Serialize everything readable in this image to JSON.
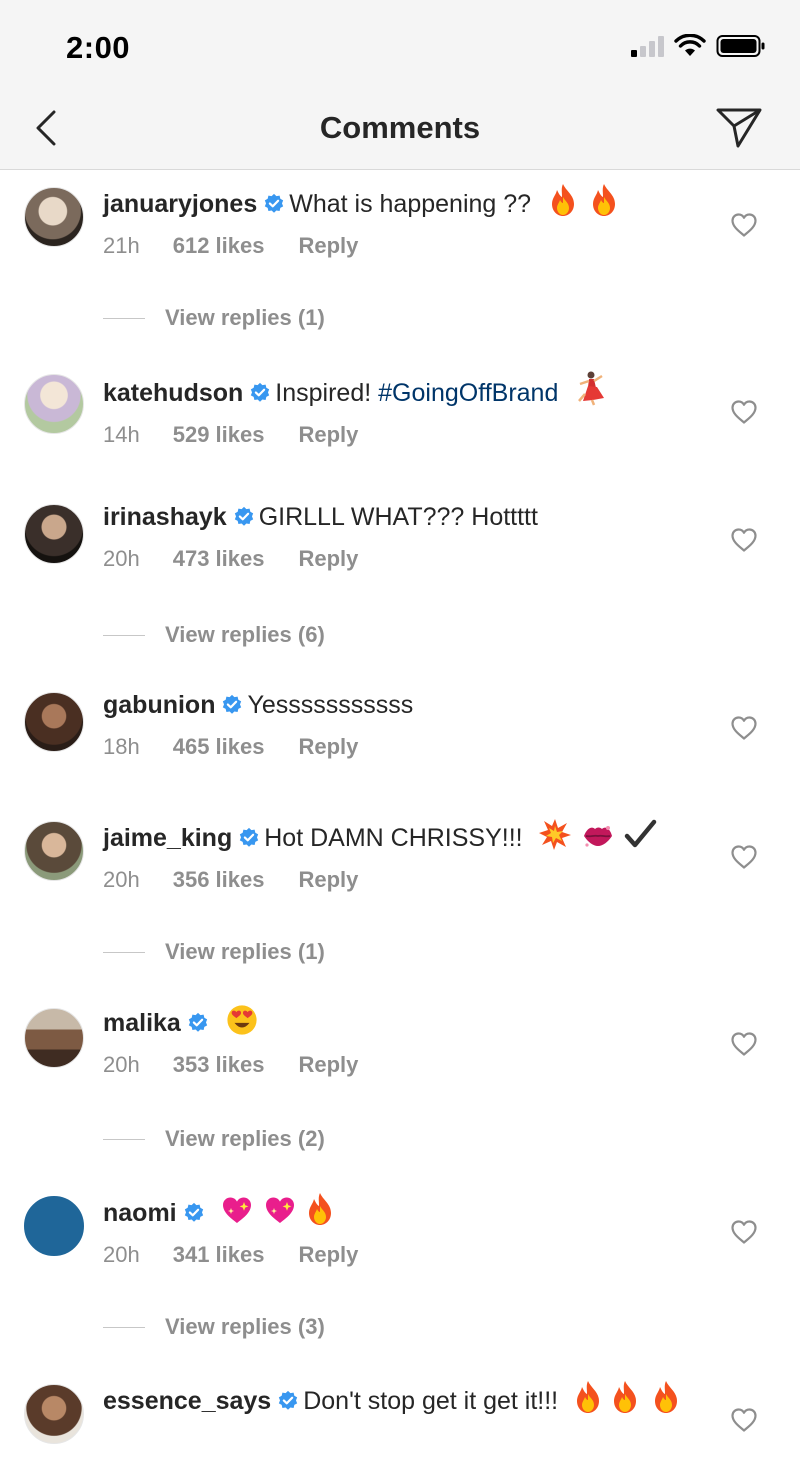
{
  "status_bar": {
    "time": "2:00"
  },
  "header": {
    "title": "Comments"
  },
  "comments": [
    {
      "username": "januaryjones",
      "verified": true,
      "text": "What is happening ??",
      "emojis": [
        "fire",
        "fire"
      ],
      "time": "21h",
      "likes": "612 likes",
      "reply_label": "Reply",
      "view_replies": "View replies (1)"
    },
    {
      "username": "katehudson",
      "verified": true,
      "text": "Inspired!",
      "hashtag": "#GoingOffBrand",
      "emojis": [
        "dancer"
      ],
      "time": "14h",
      "likes": "529 likes",
      "reply_label": "Reply"
    },
    {
      "username": "irinashayk",
      "verified": true,
      "text": "GIRLLL WHAT??? Hottttt",
      "time": "20h",
      "likes": "473 likes",
      "reply_label": "Reply",
      "view_replies": "View replies (6)"
    },
    {
      "username": "gabunion",
      "verified": true,
      "text": "Yesssssssssss",
      "time": "18h",
      "likes": "465 likes",
      "reply_label": "Reply"
    },
    {
      "username": "jaime_king",
      "verified": true,
      "text": "Hot DAMN CHRISSY!!!",
      "emojis": [
        "collision",
        "kiss-mark",
        "check-mark"
      ],
      "time": "20h",
      "likes": "356 likes",
      "reply_label": "Reply",
      "view_replies": "View replies (1)"
    },
    {
      "username": "malika",
      "verified": true,
      "text": "",
      "emojis": [
        "heart-eyes"
      ],
      "time": "20h",
      "likes": "353 likes",
      "reply_label": "Reply",
      "view_replies": "View replies (2)"
    },
    {
      "username": "naomi",
      "verified": true,
      "text": "",
      "emojis": [
        "sparkling-heart",
        "sparkling-heart",
        "fire"
      ],
      "time": "20h",
      "likes": "341 likes",
      "reply_label": "Reply",
      "view_replies": "View replies (3)"
    },
    {
      "username": "essence_says",
      "verified": true,
      "text": "Don't stop get it get it!!!",
      "emojis": [
        "fire",
        "fire",
        "fire"
      ]
    }
  ],
  "colors": {
    "verified_blue": "#3897f0",
    "muted": "#8e8e8e",
    "hashtag": "#003569",
    "naomi_avatar": "#1f6699"
  }
}
